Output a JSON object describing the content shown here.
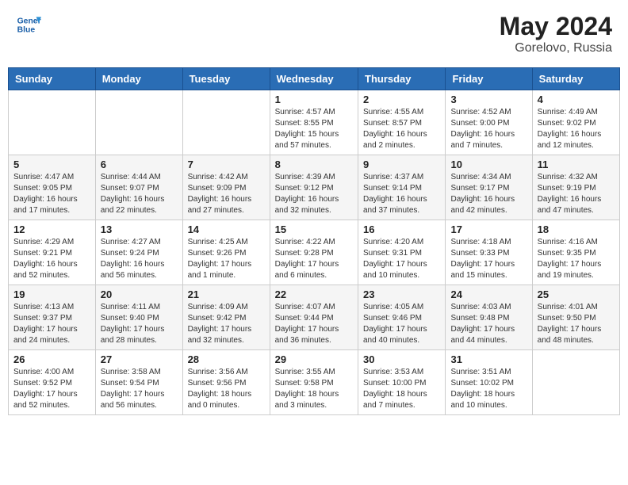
{
  "header": {
    "logo_line1": "General",
    "logo_line2": "Blue",
    "month_year": "May 2024",
    "location": "Gorelovo, Russia"
  },
  "days_of_week": [
    "Sunday",
    "Monday",
    "Tuesday",
    "Wednesday",
    "Thursday",
    "Friday",
    "Saturday"
  ],
  "weeks": [
    [
      {
        "day": "",
        "sunrise": "",
        "sunset": "",
        "daylight": ""
      },
      {
        "day": "",
        "sunrise": "",
        "sunset": "",
        "daylight": ""
      },
      {
        "day": "",
        "sunrise": "",
        "sunset": "",
        "daylight": ""
      },
      {
        "day": "1",
        "sunrise": "Sunrise: 4:57 AM",
        "sunset": "Sunset: 8:55 PM",
        "daylight": "Daylight: 15 hours and 57 minutes."
      },
      {
        "day": "2",
        "sunrise": "Sunrise: 4:55 AM",
        "sunset": "Sunset: 8:57 PM",
        "daylight": "Daylight: 16 hours and 2 minutes."
      },
      {
        "day": "3",
        "sunrise": "Sunrise: 4:52 AM",
        "sunset": "Sunset: 9:00 PM",
        "daylight": "Daylight: 16 hours and 7 minutes."
      },
      {
        "day": "4",
        "sunrise": "Sunrise: 4:49 AM",
        "sunset": "Sunset: 9:02 PM",
        "daylight": "Daylight: 16 hours and 12 minutes."
      }
    ],
    [
      {
        "day": "5",
        "sunrise": "Sunrise: 4:47 AM",
        "sunset": "Sunset: 9:05 PM",
        "daylight": "Daylight: 16 hours and 17 minutes."
      },
      {
        "day": "6",
        "sunrise": "Sunrise: 4:44 AM",
        "sunset": "Sunset: 9:07 PM",
        "daylight": "Daylight: 16 hours and 22 minutes."
      },
      {
        "day": "7",
        "sunrise": "Sunrise: 4:42 AM",
        "sunset": "Sunset: 9:09 PM",
        "daylight": "Daylight: 16 hours and 27 minutes."
      },
      {
        "day": "8",
        "sunrise": "Sunrise: 4:39 AM",
        "sunset": "Sunset: 9:12 PM",
        "daylight": "Daylight: 16 hours and 32 minutes."
      },
      {
        "day": "9",
        "sunrise": "Sunrise: 4:37 AM",
        "sunset": "Sunset: 9:14 PM",
        "daylight": "Daylight: 16 hours and 37 minutes."
      },
      {
        "day": "10",
        "sunrise": "Sunrise: 4:34 AM",
        "sunset": "Sunset: 9:17 PM",
        "daylight": "Daylight: 16 hours and 42 minutes."
      },
      {
        "day": "11",
        "sunrise": "Sunrise: 4:32 AM",
        "sunset": "Sunset: 9:19 PM",
        "daylight": "Daylight: 16 hours and 47 minutes."
      }
    ],
    [
      {
        "day": "12",
        "sunrise": "Sunrise: 4:29 AM",
        "sunset": "Sunset: 9:21 PM",
        "daylight": "Daylight: 16 hours and 52 minutes."
      },
      {
        "day": "13",
        "sunrise": "Sunrise: 4:27 AM",
        "sunset": "Sunset: 9:24 PM",
        "daylight": "Daylight: 16 hours and 56 minutes."
      },
      {
        "day": "14",
        "sunrise": "Sunrise: 4:25 AM",
        "sunset": "Sunset: 9:26 PM",
        "daylight": "Daylight: 17 hours and 1 minute."
      },
      {
        "day": "15",
        "sunrise": "Sunrise: 4:22 AM",
        "sunset": "Sunset: 9:28 PM",
        "daylight": "Daylight: 17 hours and 6 minutes."
      },
      {
        "day": "16",
        "sunrise": "Sunrise: 4:20 AM",
        "sunset": "Sunset: 9:31 PM",
        "daylight": "Daylight: 17 hours and 10 minutes."
      },
      {
        "day": "17",
        "sunrise": "Sunrise: 4:18 AM",
        "sunset": "Sunset: 9:33 PM",
        "daylight": "Daylight: 17 hours and 15 minutes."
      },
      {
        "day": "18",
        "sunrise": "Sunrise: 4:16 AM",
        "sunset": "Sunset: 9:35 PM",
        "daylight": "Daylight: 17 hours and 19 minutes."
      }
    ],
    [
      {
        "day": "19",
        "sunrise": "Sunrise: 4:13 AM",
        "sunset": "Sunset: 9:37 PM",
        "daylight": "Daylight: 17 hours and 24 minutes."
      },
      {
        "day": "20",
        "sunrise": "Sunrise: 4:11 AM",
        "sunset": "Sunset: 9:40 PM",
        "daylight": "Daylight: 17 hours and 28 minutes."
      },
      {
        "day": "21",
        "sunrise": "Sunrise: 4:09 AM",
        "sunset": "Sunset: 9:42 PM",
        "daylight": "Daylight: 17 hours and 32 minutes."
      },
      {
        "day": "22",
        "sunrise": "Sunrise: 4:07 AM",
        "sunset": "Sunset: 9:44 PM",
        "daylight": "Daylight: 17 hours and 36 minutes."
      },
      {
        "day": "23",
        "sunrise": "Sunrise: 4:05 AM",
        "sunset": "Sunset: 9:46 PM",
        "daylight": "Daylight: 17 hours and 40 minutes."
      },
      {
        "day": "24",
        "sunrise": "Sunrise: 4:03 AM",
        "sunset": "Sunset: 9:48 PM",
        "daylight": "Daylight: 17 hours and 44 minutes."
      },
      {
        "day": "25",
        "sunrise": "Sunrise: 4:01 AM",
        "sunset": "Sunset: 9:50 PM",
        "daylight": "Daylight: 17 hours and 48 minutes."
      }
    ],
    [
      {
        "day": "26",
        "sunrise": "Sunrise: 4:00 AM",
        "sunset": "Sunset: 9:52 PM",
        "daylight": "Daylight: 17 hours and 52 minutes."
      },
      {
        "day": "27",
        "sunrise": "Sunrise: 3:58 AM",
        "sunset": "Sunset: 9:54 PM",
        "daylight": "Daylight: 17 hours and 56 minutes."
      },
      {
        "day": "28",
        "sunrise": "Sunrise: 3:56 AM",
        "sunset": "Sunset: 9:56 PM",
        "daylight": "Daylight: 18 hours and 0 minutes."
      },
      {
        "day": "29",
        "sunrise": "Sunrise: 3:55 AM",
        "sunset": "Sunset: 9:58 PM",
        "daylight": "Daylight: 18 hours and 3 minutes."
      },
      {
        "day": "30",
        "sunrise": "Sunrise: 3:53 AM",
        "sunset": "Sunset: 10:00 PM",
        "daylight": "Daylight: 18 hours and 7 minutes."
      },
      {
        "day": "31",
        "sunrise": "Sunrise: 3:51 AM",
        "sunset": "Sunset: 10:02 PM",
        "daylight": "Daylight: 18 hours and 10 minutes."
      },
      {
        "day": "",
        "sunrise": "",
        "sunset": "",
        "daylight": ""
      }
    ]
  ]
}
